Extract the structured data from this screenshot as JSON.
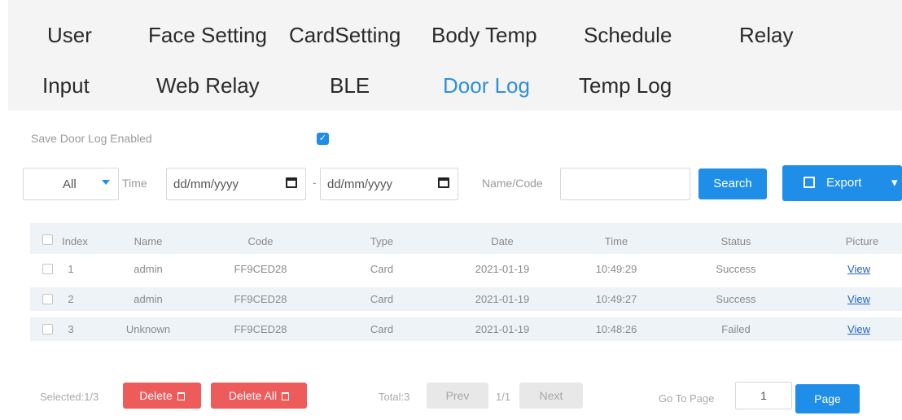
{
  "tabs": [
    {
      "label": "User"
    },
    {
      "label": "Face Setting"
    },
    {
      "label": "CardSetting"
    },
    {
      "label": "Body Temp"
    },
    {
      "label": "Schedule"
    },
    {
      "label": "Relay"
    },
    {
      "label": "Input"
    },
    {
      "label": "Web Relay"
    },
    {
      "label": "BLE"
    },
    {
      "label": "Door Log",
      "active": true
    },
    {
      "label": "Temp Log"
    }
  ],
  "save_door_log": {
    "label": "Save Door Log Enabled",
    "checked": true,
    "check_glyph": "✓"
  },
  "filter": {
    "type_value": "All",
    "time_label": "Time",
    "date_from_placeholder": "dd/mm/yyyy",
    "dash": "-",
    "date_to_placeholder": "dd/mm/yyyy",
    "name_code_label": "Name/Code",
    "name_code_value": "",
    "search_label": "Search",
    "export_label": "Export",
    "export_caret": "▾"
  },
  "table": {
    "columns": [
      "Index",
      "Name",
      "Code",
      "Type",
      "Date",
      "Time",
      "Status",
      "Picture"
    ],
    "rows": [
      {
        "index": "1",
        "name": "admin",
        "code": "FF9CED28",
        "type": "Card",
        "date": "2021-01-19",
        "time": "10:49:29",
        "status": "Success",
        "picture": "View"
      },
      {
        "index": "2",
        "name": "admin",
        "code": "FF9CED28",
        "type": "Card",
        "date": "2021-01-19",
        "time": "10:49:27",
        "status": "Success",
        "picture": "View"
      },
      {
        "index": "3",
        "name": "Unknown",
        "code": "FF9CED28",
        "type": "Card",
        "date": "2021-01-19",
        "time": "10:48:26",
        "status": "Failed",
        "picture": "View"
      }
    ]
  },
  "footer": {
    "selected": "Selected:1/3",
    "delete_label": "Delete",
    "delete_all_label": "Delete All",
    "total": "Total:3",
    "prev_label": "Prev",
    "page_info": "1/1",
    "next_label": "Next",
    "go_to_label": "Go To Page",
    "page_value": "1",
    "page_button": "Page"
  },
  "colors": {
    "accent": "#1f8ee8",
    "danger": "#ee5b5b",
    "tab_bg": "#f4f4f4",
    "row_alt": "#eef3f8"
  }
}
